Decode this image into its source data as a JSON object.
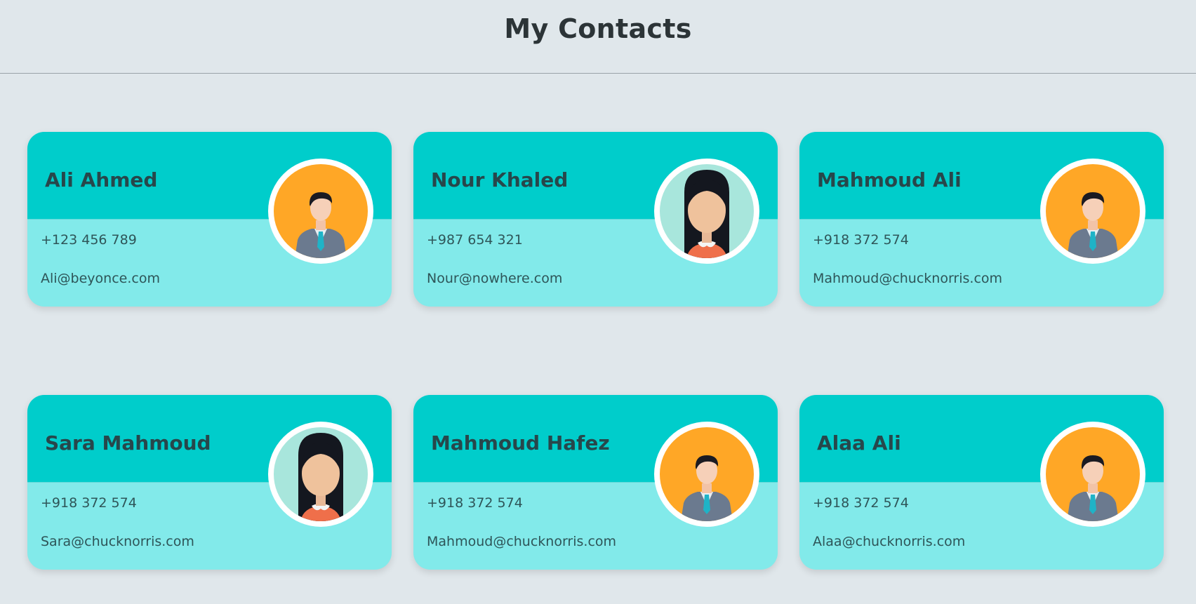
{
  "page": {
    "title": "My Contacts"
  },
  "colors": {
    "background": "#e0e7eb",
    "card_top": "#00cdcb",
    "card_bottom": "#82eaea",
    "male_avatar_bg": "#ffa726",
    "female_avatar_bg": "#a8e6dc"
  },
  "contacts": [
    {
      "name": "Ali Ahmed",
      "phone": "+123 456 789",
      "email": "Ali@beyonce.com",
      "avatar": "male-avatar-icon"
    },
    {
      "name": "Nour Khaled",
      "phone": "+987 654 321",
      "email": "Nour@nowhere.com",
      "avatar": "female-avatar-icon"
    },
    {
      "name": "Mahmoud Ali",
      "phone": "+918 372 574",
      "email": "Mahmoud@chucknorris.com",
      "avatar": "male-avatar-icon"
    },
    {
      "name": "Sara Mahmoud",
      "phone": "+918 372 574",
      "email": "Sara@chucknorris.com",
      "avatar": "female-avatar-icon"
    },
    {
      "name": "Mahmoud Hafez",
      "phone": "+918 372 574",
      "email": "Mahmoud@chucknorris.com",
      "avatar": "male-avatar-icon"
    },
    {
      "name": "Alaa Ali",
      "phone": "+918 372 574",
      "email": "Alaa@chucknorris.com",
      "avatar": "male-avatar-icon"
    }
  ]
}
